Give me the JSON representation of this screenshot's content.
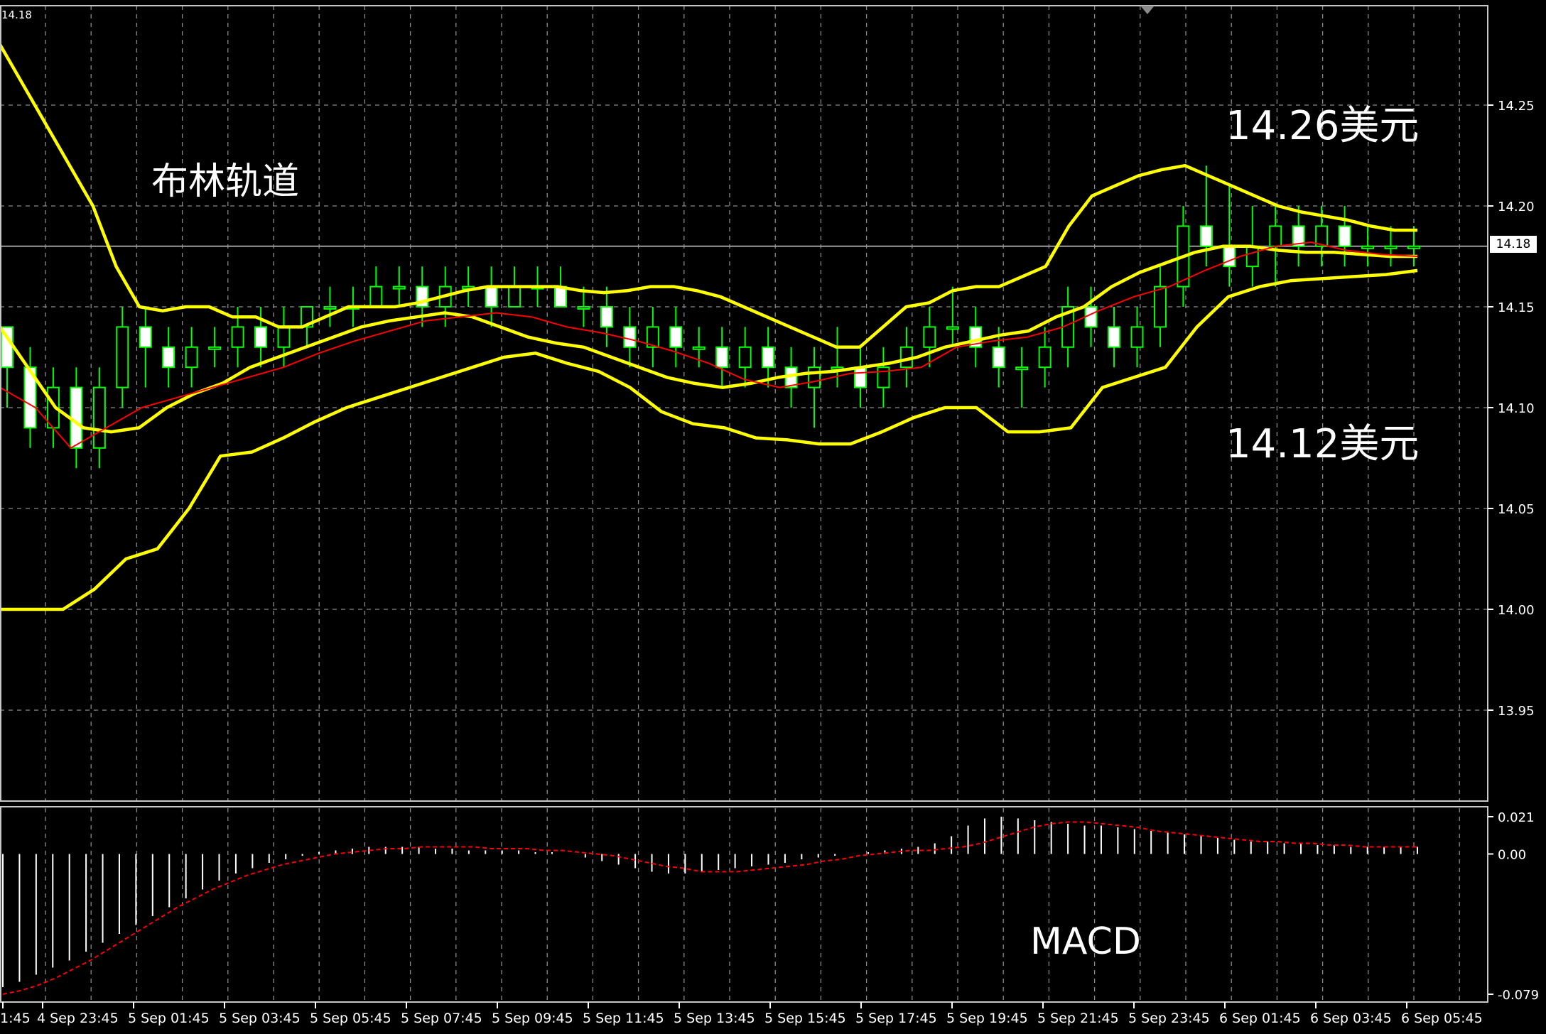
{
  "window": {
    "last_price_label": "14.18",
    "top_left_price": "14.18"
  },
  "annotations": {
    "title": "布林轨道",
    "upper_level": "14.26美元",
    "lower_level": "14.12美元",
    "indicator": "MACD"
  },
  "colors": {
    "background": "#000000",
    "grid": "#8a8a8a",
    "bull_candle": "#00ff00",
    "bear_candle_body": "#ffffff",
    "bollinger": "#ffff00",
    "ma": "#ff0000",
    "macd_histogram": "#ffffff",
    "macd_signal": "#ff0000",
    "axis_text": "#ffffff"
  },
  "chart_data": [
    {
      "type": "candlestick",
      "symbol": "",
      "timeframe": "M15",
      "y_ticks": [
        "14.25",
        "14.20",
        "14.15",
        "14.10",
        "14.05",
        "14.00",
        "13.95"
      ],
      "ylim": [
        13.9,
        14.3
      ],
      "last_price": 14.18,
      "x_ticks": [
        "1:45",
        "4 Sep 23:45",
        "5 Sep 01:45",
        "5 Sep 03:45",
        "5 Sep 05:45",
        "5 Sep 07:45",
        "5 Sep 09:45",
        "5 Sep 11:45",
        "5 Sep 13:45",
        "5 Sep 15:45",
        "5 Sep 17:45",
        "5 Sep 19:45",
        "5 Sep 21:45",
        "5 Sep 23:45",
        "6 Sep 01:45",
        "6 Sep 03:45",
        "6 Sep 05:45"
      ],
      "grid": true,
      "bollinger_upper": [
        14.28,
        14.26,
        14.24,
        14.22,
        14.2,
        14.17,
        14.15,
        14.148,
        14.15,
        14.15,
        14.145,
        14.145,
        14.14,
        14.14,
        14.145,
        14.15,
        14.15,
        14.15,
        14.152,
        14.155,
        14.158,
        14.16,
        14.16,
        14.16,
        14.16,
        14.158,
        14.157,
        14.158,
        14.16,
        14.16,
        14.158,
        14.155,
        14.15,
        14.145,
        14.14,
        14.135,
        14.13,
        14.13,
        14.14,
        14.15,
        14.152,
        14.158,
        14.16,
        14.16,
        14.165,
        14.17,
        14.19,
        14.205,
        14.21,
        14.215,
        14.218,
        14.22,
        14.215,
        14.21,
        14.205,
        14.2,
        14.197,
        14.195,
        14.193,
        14.19,
        14.188,
        14.188
      ],
      "bollinger_middle": [
        14.14,
        14.12,
        14.1,
        14.09,
        14.088,
        14.09,
        14.1,
        14.107,
        14.112,
        14.12,
        14.125,
        14.13,
        14.135,
        14.14,
        14.143,
        14.145,
        14.147,
        14.145,
        14.14,
        14.135,
        14.132,
        14.13,
        14.125,
        14.12,
        14.115,
        14.112,
        14.11,
        14.112,
        14.115,
        14.117,
        14.118,
        14.12,
        14.122,
        14.125,
        14.13,
        14.133,
        14.136,
        14.138,
        14.145,
        14.15,
        14.16,
        14.167,
        14.172,
        14.177,
        14.18,
        14.18,
        14.178,
        14.177,
        14.177,
        14.176,
        14.175,
        14.175
      ],
      "bollinger_lower": [
        14.0,
        14.0,
        14.0,
        14.01,
        14.025,
        14.03,
        14.05,
        14.076,
        14.078,
        14.085,
        14.093,
        14.1,
        14.105,
        14.11,
        14.115,
        14.12,
        14.125,
        14.127,
        14.122,
        14.118,
        14.11,
        14.098,
        14.092,
        14.09,
        14.085,
        14.084,
        14.082,
        14.082,
        14.088,
        14.095,
        14.1,
        14.1,
        14.088,
        14.088,
        14.09,
        14.11,
        14.115,
        14.12,
        14.14,
        14.155,
        14.16,
        14.163,
        14.164,
        14.165,
        14.166,
        14.168
      ],
      "moving_average": [
        14.11,
        14.1,
        14.08,
        14.09,
        14.1,
        14.105,
        14.11,
        14.115,
        14.12,
        14.127,
        14.133,
        14.138,
        14.143,
        14.145,
        14.147,
        14.145,
        14.14,
        14.137,
        14.133,
        14.128,
        14.122,
        14.114,
        14.11,
        14.113,
        14.117,
        14.118,
        14.12,
        14.13,
        14.133,
        14.135,
        14.14,
        14.148,
        14.155,
        14.16,
        14.168,
        14.175,
        14.18,
        14.182,
        14.178,
        14.176,
        14.175
      ],
      "candles_ohlc": [
        [
          14.14,
          14.14,
          14.1,
          14.12
        ],
        [
          14.12,
          14.13,
          14.08,
          14.09
        ],
        [
          14.09,
          14.12,
          14.08,
          14.11
        ],
        [
          14.11,
          14.12,
          14.07,
          14.08
        ],
        [
          14.08,
          14.12,
          14.07,
          14.11
        ],
        [
          14.11,
          14.15,
          14.1,
          14.14
        ],
        [
          14.14,
          14.15,
          14.11,
          14.13
        ],
        [
          14.13,
          14.14,
          14.11,
          14.12
        ],
        [
          14.12,
          14.14,
          14.11,
          14.13
        ],
        [
          14.13,
          14.14,
          14.12,
          14.13
        ],
        [
          14.13,
          14.15,
          14.12,
          14.14
        ],
        [
          14.14,
          14.15,
          14.12,
          14.13
        ],
        [
          14.13,
          14.15,
          14.12,
          14.14
        ],
        [
          14.14,
          14.15,
          14.13,
          14.15
        ],
        [
          14.15,
          14.16,
          14.14,
          14.15
        ],
        [
          14.15,
          14.16,
          14.14,
          14.15
        ],
        [
          14.15,
          14.17,
          14.15,
          14.16
        ],
        [
          14.16,
          14.17,
          14.15,
          14.16
        ],
        [
          14.16,
          14.17,
          14.14,
          14.15
        ],
        [
          14.15,
          14.17,
          14.14,
          14.16
        ],
        [
          14.16,
          14.17,
          14.15,
          14.16
        ],
        [
          14.16,
          14.17,
          14.14,
          14.15
        ],
        [
          14.15,
          14.17,
          14.15,
          14.16
        ],
        [
          14.16,
          14.17,
          14.15,
          14.16
        ],
        [
          14.16,
          14.17,
          14.15,
          14.15
        ],
        [
          14.15,
          14.16,
          14.14,
          14.15
        ],
        [
          14.15,
          14.16,
          14.13,
          14.14
        ],
        [
          14.14,
          14.15,
          14.12,
          14.13
        ],
        [
          14.13,
          14.15,
          14.12,
          14.14
        ],
        [
          14.14,
          14.15,
          14.12,
          14.13
        ],
        [
          14.13,
          14.14,
          14.12,
          14.13
        ],
        [
          14.13,
          14.14,
          14.11,
          14.12
        ],
        [
          14.12,
          14.14,
          14.11,
          14.13
        ],
        [
          14.13,
          14.14,
          14.11,
          14.12
        ],
        [
          14.12,
          14.13,
          14.1,
          14.11
        ],
        [
          14.11,
          14.13,
          14.09,
          14.12
        ],
        [
          14.12,
          14.14,
          14.11,
          14.12
        ],
        [
          14.12,
          14.13,
          14.1,
          14.11
        ],
        [
          14.11,
          14.13,
          14.1,
          14.12
        ],
        [
          14.12,
          14.14,
          14.11,
          14.13
        ],
        [
          14.13,
          14.15,
          14.12,
          14.14
        ],
        [
          14.14,
          14.16,
          14.13,
          14.14
        ],
        [
          14.14,
          14.15,
          14.12,
          14.13
        ],
        [
          14.13,
          14.14,
          14.11,
          14.12
        ],
        [
          14.12,
          14.13,
          14.1,
          14.12
        ],
        [
          14.12,
          14.14,
          14.11,
          14.13
        ],
        [
          14.13,
          14.16,
          14.12,
          14.15
        ],
        [
          14.15,
          14.16,
          14.13,
          14.14
        ],
        [
          14.14,
          14.15,
          14.12,
          14.13
        ],
        [
          14.13,
          14.15,
          14.12,
          14.14
        ],
        [
          14.14,
          14.17,
          14.13,
          14.16
        ],
        [
          14.16,
          14.2,
          14.15,
          14.19
        ],
        [
          14.19,
          14.22,
          14.17,
          14.18
        ],
        [
          14.18,
          14.21,
          14.16,
          14.17
        ],
        [
          14.17,
          14.2,
          14.16,
          14.18
        ],
        [
          14.18,
          14.2,
          14.16,
          14.19
        ],
        [
          14.19,
          14.2,
          14.17,
          14.18
        ],
        [
          14.18,
          14.2,
          14.17,
          14.19
        ],
        [
          14.19,
          14.2,
          14.17,
          14.18
        ],
        [
          14.18,
          14.19,
          14.17,
          14.18
        ],
        [
          14.18,
          14.19,
          14.17,
          14.18
        ],
        [
          14.18,
          14.19,
          14.17,
          14.18
        ]
      ],
      "bollinger_band_top_label": "14.26美元",
      "bollinger_band_bottom_label": "14.12美元"
    },
    {
      "type": "bar",
      "indicator": "MACD",
      "y_ticks": [
        "0.021",
        "0.00",
        "-0.079"
      ],
      "ylim": [
        -0.079,
        0.021
      ],
      "histogram": [
        -0.075,
        -0.072,
        -0.068,
        -0.064,
        -0.06,
        -0.055,
        -0.05,
        -0.045,
        -0.04,
        -0.035,
        -0.03,
        -0.025,
        -0.02,
        -0.015,
        -0.011,
        -0.008,
        -0.005,
        -0.003,
        -0.001,
        0.001,
        0.002,
        0.003,
        0.004,
        0.004,
        0.004,
        0.004,
        0.003,
        0.003,
        0.002,
        0.002,
        0.002,
        0.002,
        0.001,
        0.001,
        0.0,
        -0.002,
        -0.004,
        -0.006,
        -0.008,
        -0.01,
        -0.011,
        -0.011,
        -0.01,
        -0.009,
        -0.008,
        -0.007,
        -0.006,
        -0.005,
        -0.003,
        -0.002,
        -0.001,
        0.0,
        0.001,
        0.002,
        0.003,
        0.004,
        0.006,
        0.01,
        0.016,
        0.02,
        0.021,
        0.02,
        0.019,
        0.018,
        0.017,
        0.016,
        0.016,
        0.015,
        0.014,
        0.013,
        0.012,
        0.011,
        0.01,
        0.009,
        0.008,
        0.007,
        0.007,
        0.006,
        0.006,
        0.005,
        0.005,
        0.004,
        0.004,
        0.004,
        0.004,
        0.004
      ],
      "signal": [
        -0.079,
        -0.077,
        -0.074,
        -0.07,
        -0.065,
        -0.06,
        -0.054,
        -0.048,
        -0.042,
        -0.036,
        -0.03,
        -0.025,
        -0.02,
        -0.016,
        -0.012,
        -0.009,
        -0.006,
        -0.004,
        -0.002,
        0.0,
        0.001,
        0.002,
        0.003,
        0.003,
        0.004,
        0.004,
        0.004,
        0.004,
        0.003,
        0.003,
        0.003,
        0.002,
        0.002,
        0.001,
        0.0,
        -0.001,
        -0.003,
        -0.005,
        -0.007,
        -0.008,
        -0.01,
        -0.01,
        -0.01,
        -0.009,
        -0.008,
        -0.007,
        -0.006,
        -0.004,
        -0.003,
        -0.001,
        0.0,
        0.001,
        0.002,
        0.002,
        0.003,
        0.004,
        0.006,
        0.009,
        0.012,
        0.015,
        0.017,
        0.018,
        0.018,
        0.017,
        0.016,
        0.015,
        0.013,
        0.012,
        0.011,
        0.01,
        0.009,
        0.008,
        0.007,
        0.007,
        0.006,
        0.006,
        0.005,
        0.005,
        0.004,
        0.004,
        0.004,
        0.004
      ]
    }
  ]
}
